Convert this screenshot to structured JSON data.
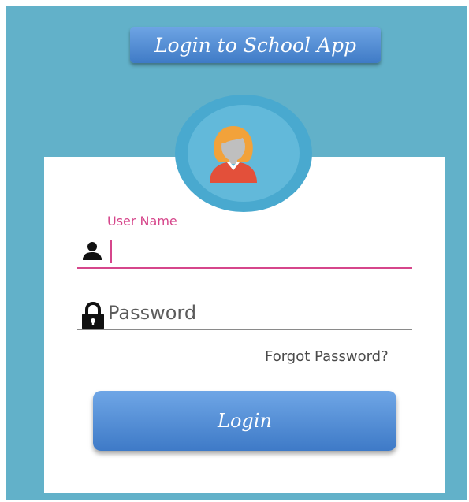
{
  "header": {
    "title": "Login to School App"
  },
  "avatar": {
    "icon": "user-avatar-icon",
    "ring_color": "#49a9cf",
    "hair_color": "#f2a23a",
    "shirt_color": "#e3503a"
  },
  "form": {
    "username": {
      "label": "User Name",
      "value": "",
      "icon": "person-icon"
    },
    "password": {
      "placeholder": "Password",
      "value": "",
      "icon": "lock-icon"
    },
    "forgot_label": "Forgot Password?",
    "login_label": "Login"
  },
  "colors": {
    "background": "#62b1c9",
    "accent": "#d6468b",
    "button": "#4f8ad4"
  }
}
